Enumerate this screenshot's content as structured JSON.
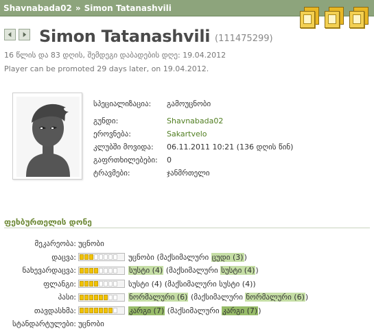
{
  "breadcrumb": {
    "team": "Shavnabada02",
    "separator": "»",
    "player": "Simon Tatanashvili"
  },
  "header": {
    "name": "Simon Tatanashvili",
    "id": "(111475299)"
  },
  "info": {
    "age": "16 წლის და 83 დღის, შემდეგი დაბადების დღე: 19.04.2012",
    "promotion": "Player can be promoted 29 days later, on 19.04.2012."
  },
  "details": {
    "specialty": {
      "label": "სპეციალიზაცია:",
      "value": "გამოუცნობი"
    },
    "rows": [
      {
        "label": "გუნდი:",
        "value": "Shavnabada02",
        "link": true
      },
      {
        "label": "ეროვნება:",
        "value": "Sakartvelo",
        "link": true
      },
      {
        "label": "კლუბში მოვიდა:",
        "value": "06.11.2011 10:21 (136 დღის წინ)",
        "link": false
      },
      {
        "label": "გაფრთხილებები:",
        "value": "0",
        "link": false
      },
      {
        "label": "ტრავმები:",
        "value": "ჯანმრთელი",
        "link": false
      }
    ]
  },
  "skills": {
    "title": "ფეხბურთელის დონე",
    "keeper": {
      "label": "მეკარეობა:",
      "value": "უცნობი"
    },
    "rows": [
      {
        "label": "დაცვა:",
        "level": 3,
        "current": "უცნობი",
        "max_prefix": "(მაქსიმალური",
        "max_value": "ცუდი (3)",
        "max_suffix": ")",
        "current_hl": "",
        "max_hl": "light"
      },
      {
        "label": "ნახევარდაცვა:",
        "level": 4,
        "current": "სუსტი (4)",
        "max_prefix": "(მაქსიმალური",
        "max_value": "სუსტი (4)",
        "max_suffix": ")",
        "current_hl": "light",
        "max_hl": "light"
      },
      {
        "label": "ფლანგი:",
        "level": 4,
        "current": "სუსტი (4)",
        "max_prefix": "(მაქსიმალური",
        "max_value": "სუსტი (4)",
        "max_suffix": ")",
        "current_hl": "",
        "max_hl": ""
      },
      {
        "label": "პასი:",
        "level": 6,
        "current": "ნორმალური (6)",
        "max_prefix": "(მაქსიმალური",
        "max_value": "ნორმალური (6)",
        "max_suffix": ")",
        "current_hl": "light",
        "max_hl": "light"
      },
      {
        "label": "თავდასხმა:",
        "level": 7,
        "current": "კარგი (7)",
        "max_prefix": "(მაქსიმალური",
        "max_value": "კარგი (7)",
        "max_suffix": ")",
        "current_hl": "dark",
        "max_hl": "dark"
      }
    ],
    "standards": {
      "label": "სტანდარტულები:",
      "value": "უცნობი"
    }
  },
  "colors": {
    "header_bar": "#8da47c",
    "link": "#4f7d1f",
    "skill_bar": "#f2c300",
    "section_title": "#6f8a38"
  }
}
